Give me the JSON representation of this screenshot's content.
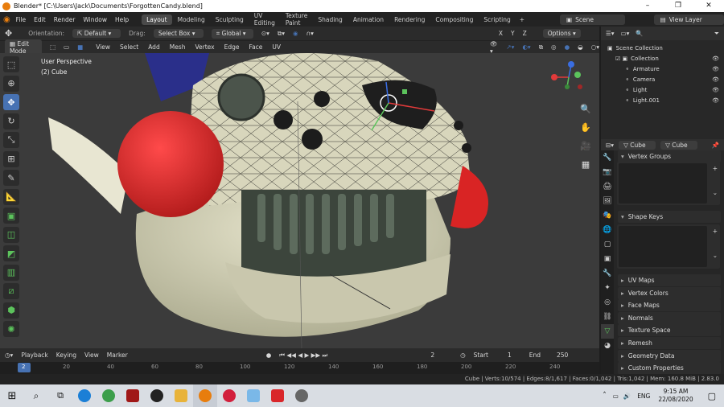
{
  "titlebar": {
    "title": "Blender* [C:\\Users\\Jack\\Documents\\ForgottenCandy.blend]",
    "min": "–",
    "max": "❐",
    "close": "✕"
  },
  "menu": [
    "File",
    "Edit",
    "Render",
    "Window",
    "Help"
  ],
  "workspaces": [
    "Layout",
    "Modeling",
    "Sculpting",
    "UV Editing",
    "Texture Paint",
    "Shading",
    "Animation",
    "Rendering",
    "Compositing",
    "Scripting"
  ],
  "add_workspace": "+",
  "scene": "Scene",
  "view_layer": "View Layer",
  "header1": {
    "orientation_label": "Orientation:",
    "orientation_value": "Default",
    "drag_label": "Drag:",
    "drag_value": "Select Box",
    "transform_value": "Global",
    "options": "Options"
  },
  "header2": {
    "mode": "Edit Mode",
    "menus": [
      "View",
      "Select",
      "Add",
      "Mesh",
      "Vertex",
      "Edge",
      "Face",
      "UV"
    ]
  },
  "viewport": {
    "perspective": "User Perspective",
    "object": "(2) Cube"
  },
  "gizmo": {
    "x": "X",
    "y": "Y",
    "z": "Z"
  },
  "timeline": {
    "playback": "Playback",
    "keying": "Keying",
    "view": "View",
    "marker": "Marker",
    "current_frame": "2",
    "start_label": "Start",
    "start": "1",
    "end_label": "End",
    "end": "250"
  },
  "ruler_ticks": [
    "20",
    "40",
    "60",
    "80",
    "100",
    "120",
    "140",
    "160",
    "180",
    "200",
    "220",
    "240"
  ],
  "ruler_current": "2",
  "status": "Cube | Verts:10/574 | Edges:8/1,617 | Faces:0/1,042 | Tris:1,042 | Mem: 160.8 MiB | 2.83.0",
  "outliner": {
    "root": "Scene Collection",
    "items": [
      {
        "label": "Collection",
        "indent": 0
      },
      {
        "label": "Armature",
        "indent": 1
      },
      {
        "label": "Camera",
        "indent": 1
      },
      {
        "label": "Light",
        "indent": 1
      },
      {
        "label": "Light.001",
        "indent": 1
      }
    ]
  },
  "properties": {
    "object": "Cube",
    "mesh": "Cube",
    "vertex_groups": "Vertex Groups",
    "shape_keys": "Shape Keys",
    "sections": [
      "UV Maps",
      "Vertex Colors",
      "Face Maps",
      "Normals",
      "Texture Space",
      "Remesh",
      "Geometry Data",
      "Custom Properties"
    ]
  },
  "taskbar": {
    "lang": "ENG",
    "time": "9:15 AM",
    "date": "22/08/2020"
  },
  "colors": {
    "accent": "#4772b3",
    "header": "#2b2b2b",
    "viewport": "#3b3b3b",
    "active_tab": "#4a4a4a"
  }
}
